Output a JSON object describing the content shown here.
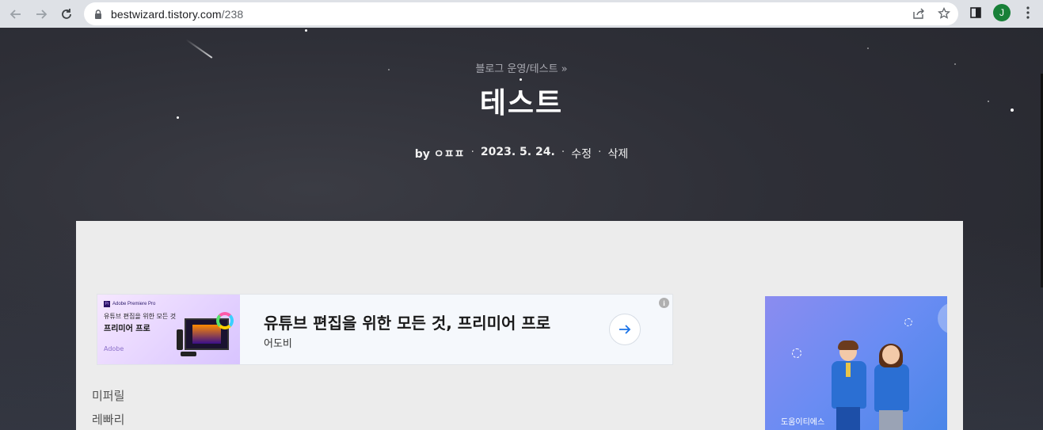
{
  "browser": {
    "url_host": "bestwizard.tistory.com",
    "url_path": "/238",
    "profile_initial": "J",
    "icons": [
      "back-arrow-icon",
      "forward-arrow-icon",
      "reload-icon",
      "lock-icon",
      "share-icon",
      "star-icon",
      "side-panel-icon",
      "kebab-menu-icon"
    ]
  },
  "post": {
    "breadcrumb": "블로그 운영/테스트 »",
    "title": "테스트",
    "meta": {
      "by": "by",
      "author": "ㅇㅍㅍ",
      "date": "2023. 5. 24.",
      "edit": "수정",
      "delete": "삭제",
      "separator": "·"
    },
    "body_lines": [
      "미퍼릴",
      "레빠리"
    ]
  },
  "ad_banner": {
    "brand": "Adobe Premiere Pro",
    "thumb_line1": "유튜브 편집을 위한 모든 것",
    "thumb_line2": "프리미어 프로",
    "thumb_logo": "Adobe",
    "title": "유튜브 편집을 위한 모든 것, 프리미어 프로",
    "advertiser": "어도비",
    "info": "i",
    "accent": "#1a73e8"
  },
  "side_ad": {
    "label": "도움이티에스"
  },
  "colors": {
    "hero_bg": "#2a2b33",
    "content_bg": "#ececec",
    "chrome_bg": "#dee1e6",
    "avatar_bg": "#188038"
  }
}
